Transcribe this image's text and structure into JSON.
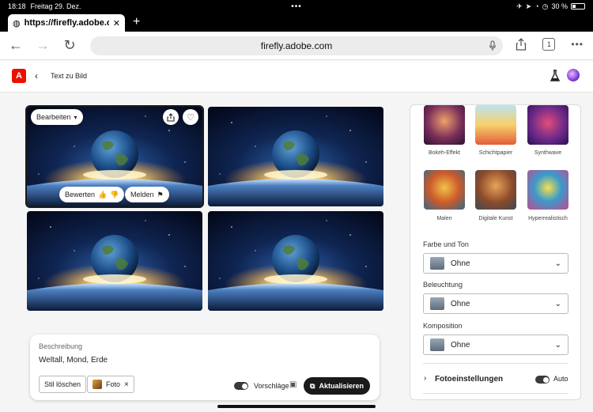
{
  "status": {
    "time": "18:18",
    "date": "Freitag 29. Dez.",
    "battery": "30 %",
    "battery_level": 0.3
  },
  "browser": {
    "tab_url": "https://firefly.adobe.com",
    "address": "firefly.adobe.com",
    "tab_count": "1"
  },
  "app": {
    "logo_letter": "A",
    "page_title": "Text zu Bild"
  },
  "image_actions": {
    "edit": "Bearbeiten",
    "rate": "Bewerten",
    "report": "Melden"
  },
  "prompt": {
    "label": "Beschreibung",
    "text": "Weltall, Mond, Erde",
    "clear_style": "Stil löschen",
    "style_tag": "Foto",
    "suggestions": "Vorschläge",
    "update": "Aktualisieren"
  },
  "styles": [
    {
      "label": "Bokeh-Effekt"
    },
    {
      "label": "Schichtpapier"
    },
    {
      "label": "Synthwave"
    },
    {
      "label": "Malen"
    },
    {
      "label": "Digitale Kunst"
    },
    {
      "label": "Hyperrealistisch"
    }
  ],
  "settings": {
    "color_tone": {
      "label": "Farbe und Ton",
      "value": "Ohne"
    },
    "lighting": {
      "label": "Beleuchtung",
      "value": "Ohne"
    },
    "composition": {
      "label": "Komposition",
      "value": "Ohne"
    },
    "photo_settings": {
      "label": "Fotoeinstellungen",
      "toggle_label": "Auto"
    }
  }
}
